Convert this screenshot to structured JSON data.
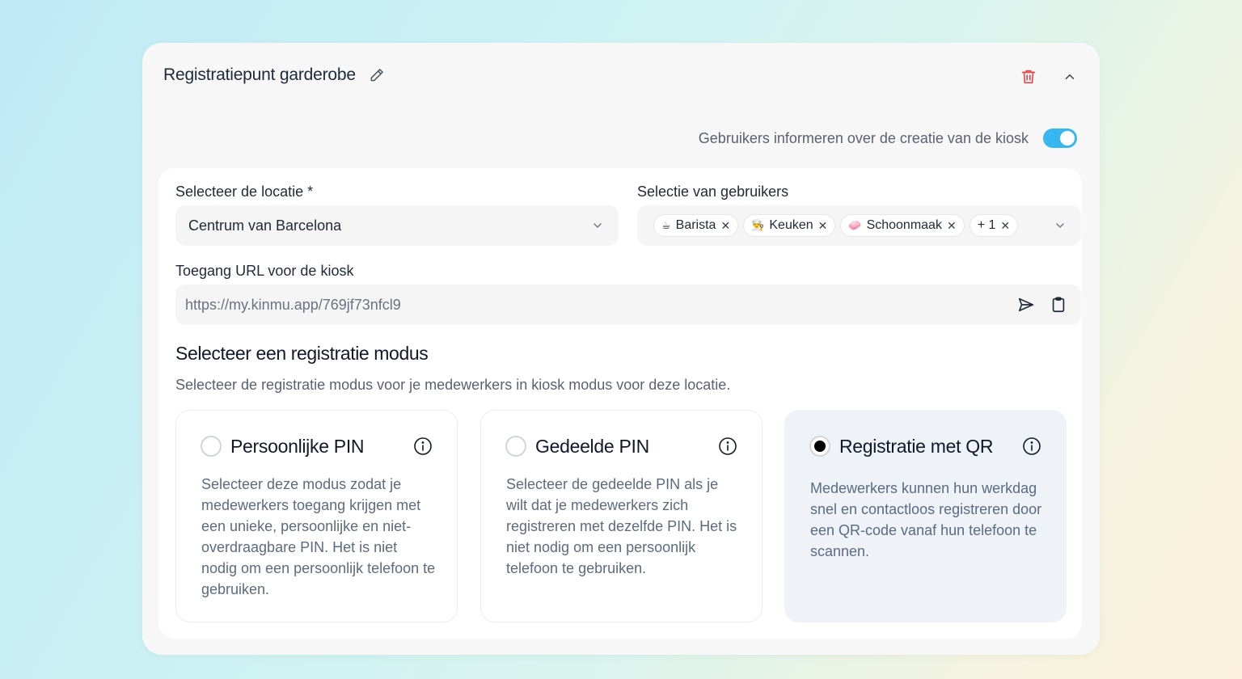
{
  "kiosk": {
    "title": "Registratiepunt garderobe",
    "notify_label": "Gebruikers informeren over de creatie van de kiosk",
    "notify_enabled": true
  },
  "location": {
    "label": "Selecteer de locatie *",
    "value": "Centrum van Barcelona"
  },
  "users": {
    "label": "Selectie van gebruikers",
    "chips": [
      {
        "emoji": "☕",
        "label": "Barista"
      },
      {
        "emoji": "👨‍🍳",
        "label": "Keuken"
      },
      {
        "emoji": "🧼",
        "label": "Schoonmaak"
      },
      {
        "emoji": "",
        "label": "+ 1"
      }
    ]
  },
  "access": {
    "label": "Toegang URL voor de kiosk",
    "url": "https://my.kinmu.app/769jf73nfcl9"
  },
  "modes": {
    "title": "Selecteer een registratie modus",
    "description": "Selecteer de registratie modus voor je medewerkers in kiosk modus voor deze locatie.",
    "options": [
      {
        "title": "Persoonlijke PIN",
        "description": "Selecteer deze modus zodat je medewerkers toegang krijgen met een unieke, persoonlijke en niet-overdraagbare PIN. Het is niet nodig om een persoonlijk telefoon te gebruiken.",
        "selected": false
      },
      {
        "title": "Gedeelde PIN",
        "description": "Selecteer de gedeelde PIN als je wilt dat je medewerkers zich registreren met dezelfde PIN. Het is niet nodig om een persoonlijk telefoon te gebruiken.",
        "selected": false
      },
      {
        "title": "Registratie met QR",
        "description": "Medewerkers kunnen hun werkdag snel en contactloos registreren door een QR-code vanaf hun telefoon te scannen.",
        "selected": true
      }
    ]
  },
  "colors": {
    "accent": "#38b6f0",
    "danger": "#e5484d"
  }
}
